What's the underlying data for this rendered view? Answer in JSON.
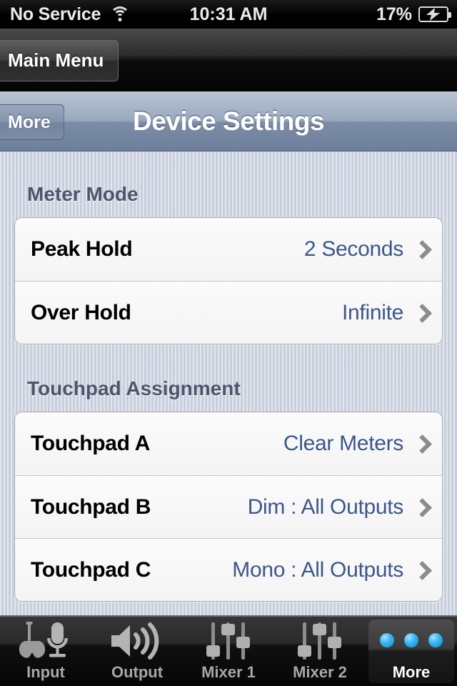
{
  "status_bar": {
    "carrier": "No Service",
    "wifi_icon": "wifi-icon",
    "time": "10:31 AM",
    "battery_percent": "17%",
    "battery_icon": "battery-charging-icon"
  },
  "toolbar": {
    "back_label": "Main Menu"
  },
  "navbar": {
    "back_label": "More",
    "title": "Device Settings"
  },
  "sections": [
    {
      "header": "Meter Mode",
      "rows": [
        {
          "label": "Peak Hold",
          "value": "2 Seconds",
          "chevron": "chevron-right-icon"
        },
        {
          "label": "Over Hold",
          "value": "Infinite",
          "chevron": "chevron-right-icon"
        }
      ]
    },
    {
      "header": "Touchpad Assignment",
      "rows": [
        {
          "label": "Touchpad A",
          "value": "Clear Meters",
          "chevron": "chevron-right-icon"
        },
        {
          "label": "Touchpad B",
          "value": "Dim : All Outputs",
          "chevron": "chevron-right-icon"
        },
        {
          "label": "Touchpad C",
          "value": "Mono : All Outputs",
          "chevron": "chevron-right-icon"
        }
      ]
    }
  ],
  "tabbar": {
    "tabs": [
      {
        "label": "Input",
        "icon": "guitar-microphone-icon",
        "selected": false
      },
      {
        "label": "Output",
        "icon": "speaker-waves-icon",
        "selected": false
      },
      {
        "label": "Mixer 1",
        "icon": "faders-icon",
        "selected": false
      },
      {
        "label": "Mixer 2",
        "icon": "faders-icon",
        "selected": false
      },
      {
        "label": "More",
        "icon": "three-dots-icon",
        "selected": true
      }
    ]
  },
  "colors": {
    "accent_blue": "#3c5788",
    "section_header": "#4a566e",
    "navbar_top": "#b9c4d3",
    "navbar_bottom": "#6d7f9b",
    "tab_dot": "#34b3f1"
  }
}
